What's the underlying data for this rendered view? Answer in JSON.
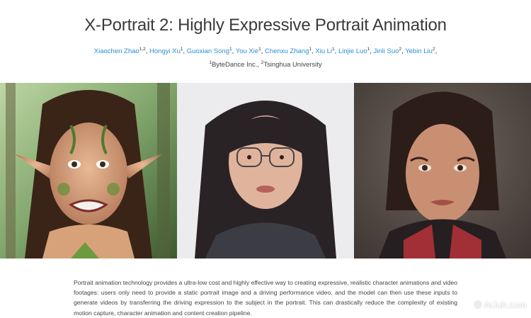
{
  "page": {
    "title": "X-Portrait 2: Highly Expressive Portrait Animation"
  },
  "authors": [
    {
      "name": "Xiaochen Zhao",
      "sup": "1,2",
      "sep": ", "
    },
    {
      "name": "Hongyi Xu",
      "sup": "1",
      "sep": ", "
    },
    {
      "name": "Guoxian Song",
      "sup": "1",
      "sep": ", "
    },
    {
      "name": "You Xie",
      "sup": "1",
      "sep": ", "
    },
    {
      "name": "Chenxu Zhang",
      "sup": "1",
      "sep": ", "
    },
    {
      "name": "Xiu Li",
      "sup": "1",
      "sep": ", "
    },
    {
      "name": "Linjie Luo",
      "sup": "1",
      "sep": ", "
    },
    {
      "name": "Jinli Suo",
      "sup": "2",
      "sep": ", "
    },
    {
      "name": "Yebin Liu",
      "sup": "2",
      "sep": ","
    }
  ],
  "affiliations": [
    {
      "sup": "1",
      "name": "ByteDance Inc.",
      "sep": ", "
    },
    {
      "sup": "2",
      "name": "Tsinghua University",
      "sep": ""
    }
  ],
  "panels": [
    {
      "name": "elf-portrait",
      "desc": "fantasy elf woman with leaf face paint"
    },
    {
      "name": "driving-video-portrait",
      "desc": "woman with glasses"
    },
    {
      "name": "painted-portrait",
      "desc": "woman in painted style"
    }
  ],
  "abstract": "Portrait animation technology provides a ultra-low cost and highly effective way to creating expressive, realistic character animations and video footages: users only need to provide a static portrait image and a driving performance video, and the model can then use these inputs to generate videos by transferring the driving expression to the subject in the portrait. This can drastically reduce the complexity of existing motion capture, character animation and content creation pipeline.",
  "watermark": "AiJuh.com"
}
